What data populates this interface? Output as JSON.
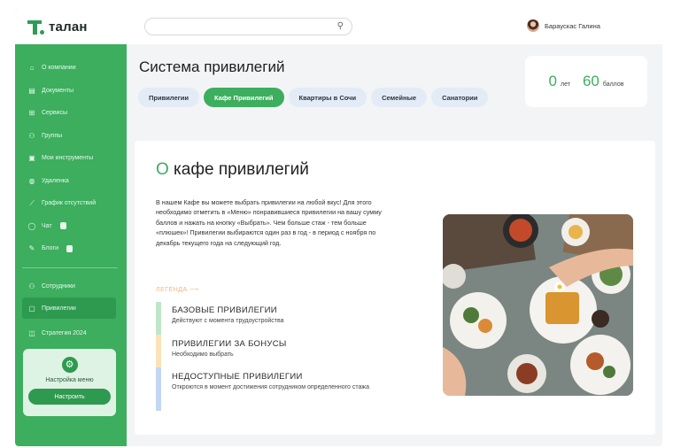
{
  "brand": {
    "name": "талан",
    "color": "#3cae5e"
  },
  "sidebar": {
    "items": [
      {
        "label": "О компании",
        "icon": "home-icon"
      },
      {
        "label": "Документы",
        "icon": "document-icon"
      },
      {
        "label": "Сервисы",
        "icon": "grid-icon"
      },
      {
        "label": "Группы",
        "icon": "group-icon"
      },
      {
        "label": "Мои инструменты",
        "icon": "briefcase-icon"
      },
      {
        "label": "Удаленка",
        "icon": "globe-icon"
      },
      {
        "label": "График отсутствий",
        "icon": "chart-icon"
      },
      {
        "label": "Чат",
        "icon": "chat-icon"
      },
      {
        "label": "Блоги",
        "icon": "pen-icon"
      }
    ],
    "items2": [
      {
        "label": "Сотрудники",
        "icon": "people-icon"
      },
      {
        "label": "Привилегии",
        "icon": "privilege-icon"
      },
      {
        "label": "Стратегия 2024",
        "icon": "book-icon"
      }
    ],
    "menu_card": {
      "label": "Настройка меню",
      "button": "Настроить"
    }
  },
  "header": {
    "search_placeholder": "",
    "user_name": "Бараускас Галина"
  },
  "page": {
    "title": "Система привилегий",
    "tabs": [
      "Привилегии",
      "Кафе Привилегий",
      "Квартиры в Сочи",
      "Семейные",
      "Санатории"
    ],
    "active_tab": 1
  },
  "stats": {
    "years_value": "0",
    "years_unit": "лет",
    "points_value": "60",
    "points_unit": "баллов"
  },
  "content": {
    "title_first": "О",
    "title_rest": " кафе привилегий",
    "description": "В нашем Кафе вы можете выбрать привилегии на любой вкус! Для этого необходимо отметить в «Меню» понравившиеся привилегии на вашу сумму баллов и нажать на кнопку «Выбрать». Чем больше стаж - тем больше «плюшек»! Привилегии выбираются один раз в год - в период с ноября по декабрь текущего года на следующий год.",
    "legend_label": "ЛЕГЕНДА",
    "legend": [
      {
        "title": "БАЗОВЫЕ ПРИВИЛЕГИИ",
        "subtitle": "Действуют с момента трудоустройства",
        "color": "#bfe6c9"
      },
      {
        "title": "ПРИВИЛЕГИИ ЗА БОНУСЫ",
        "subtitle": "Необходимо выбрать",
        "color": "#fbe3b9"
      },
      {
        "title": "НЕДОСТУПНЫЕ ПРИВИЛЕГИИ",
        "subtitle": "Откроются в момент достижения сотрудником определенного стажа",
        "color": "#c3d7f4"
      }
    ]
  }
}
